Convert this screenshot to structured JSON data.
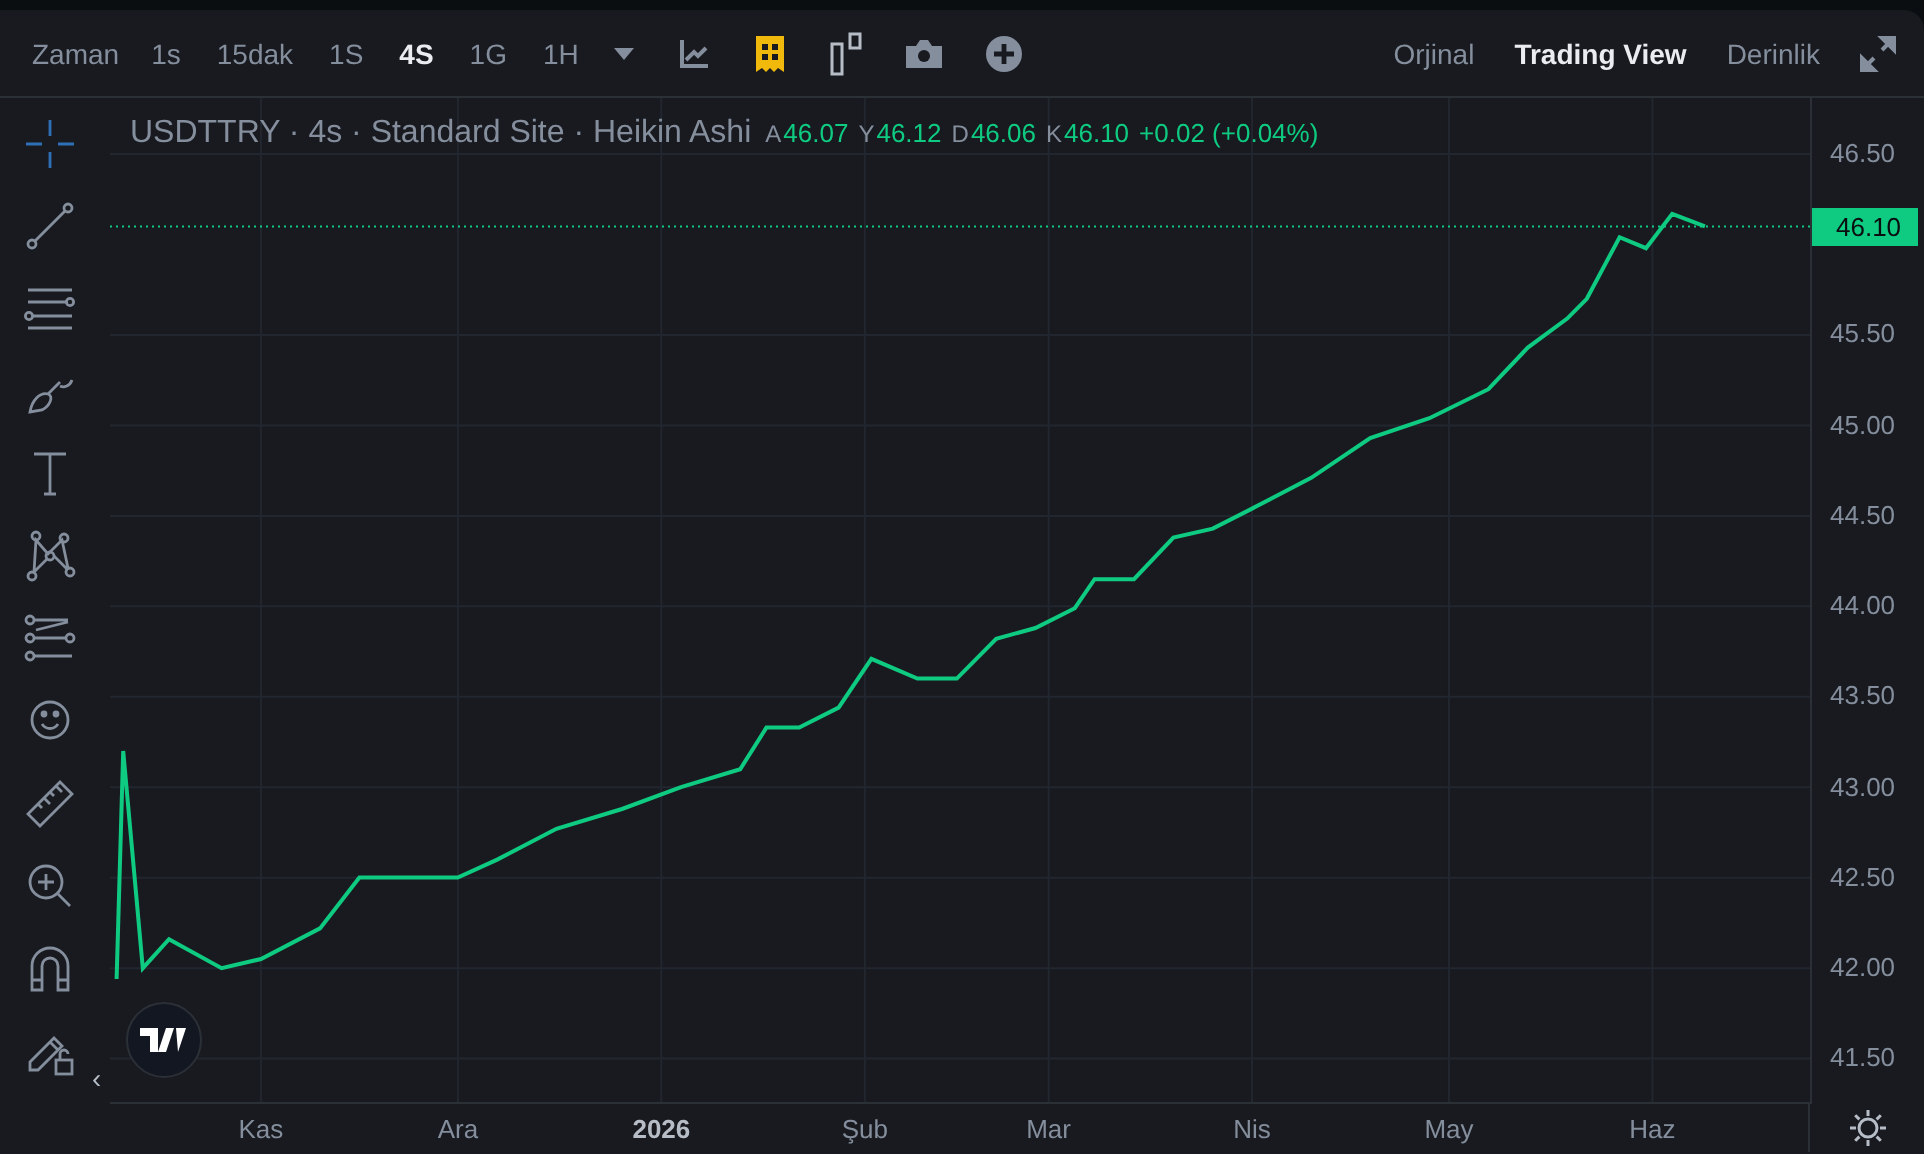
{
  "toolbar": {
    "time_label": "Zaman",
    "intervals": [
      {
        "label": "1s",
        "selected": false
      },
      {
        "label": "15dak",
        "selected": false
      },
      {
        "label": "1S",
        "selected": false
      },
      {
        "label": "4S",
        "selected": true
      },
      {
        "label": "1G",
        "selected": false
      },
      {
        "label": "1H",
        "selected": false
      }
    ],
    "views": [
      {
        "label": "Orjinal",
        "selected": false
      },
      {
        "label": "Trading View",
        "selected": true
      },
      {
        "label": "Derinlik",
        "selected": false
      }
    ]
  },
  "tools": [
    {
      "kind": "crosshair",
      "selected": true
    },
    {
      "kind": "trendline",
      "selected": false
    },
    {
      "kind": "hlines",
      "selected": false
    },
    {
      "kind": "brush",
      "selected": false
    },
    {
      "kind": "text",
      "selected": false
    },
    {
      "kind": "pattern",
      "selected": false
    },
    {
      "kind": "fib",
      "selected": false
    },
    {
      "kind": "smiley",
      "selected": false
    },
    {
      "kind": "ruler",
      "selected": false
    },
    {
      "kind": "zoom",
      "selected": false
    },
    {
      "kind": "magnet",
      "selected": false
    },
    {
      "kind": "lock",
      "selected": false
    }
  ],
  "collapse_arrow": "‹",
  "legend": {
    "title": "USDTTRY · 4s · Standard Site · Heikin Ashi",
    "ohlc": [
      {
        "key": "A",
        "value": "46.07"
      },
      {
        "key": "Y",
        "value": "46.12"
      },
      {
        "key": "D",
        "value": "46.06"
      },
      {
        "key": "K",
        "value": "46.10"
      }
    ],
    "change": "+0.02 (+0.04%)"
  },
  "last_price": "46.10",
  "chart": {
    "chart_data": {
      "type": "line",
      "x": [
        "2025-10-10",
        "2025-10-11",
        "2025-10-14",
        "2025-10-18",
        "2025-10-26",
        "2025-11-01",
        "2025-11-10",
        "2025-11-16",
        "2025-11-22",
        "2025-12-01",
        "2025-12-07",
        "2025-12-16",
        "2025-12-26",
        "2026-01-04",
        "2026-01-13",
        "2026-01-17",
        "2026-01-22",
        "2026-01-28",
        "2026-02-02",
        "2026-02-09",
        "2026-02-15",
        "2026-02-21",
        "2026-02-27",
        "2026-03-05",
        "2026-03-08",
        "2026-03-14",
        "2026-03-20",
        "2026-03-26",
        "2026-04-01",
        "2026-04-10",
        "2026-04-19",
        "2026-04-28",
        "2026-05-07",
        "2026-05-13",
        "2026-05-19",
        "2026-05-22",
        "2026-05-27",
        "2026-05-31",
        "2026-06-04",
        "2026-06-09"
      ],
      "series": [
        {
          "color": "#0ecb81",
          "values": [
            41.94,
            43.2,
            42.0,
            42.16,
            42.0,
            42.05,
            42.22,
            42.5,
            42.5,
            42.5,
            42.6,
            42.77,
            42.88,
            43.0,
            43.1,
            43.33,
            43.33,
            43.44,
            43.71,
            43.6,
            43.6,
            43.82,
            43.88,
            43.99,
            44.15,
            44.15,
            44.38,
            44.43,
            44.54,
            44.71,
            44.93,
            45.04,
            45.2,
            45.43,
            45.59,
            45.7,
            46.04,
            45.98,
            46.17,
            46.1
          ]
        }
      ],
      "xlim": [
        "2025-10-09",
        "2026-06-25"
      ],
      "ylim": [
        41.26,
        46.81
      ],
      "grid": true,
      "ref_lines": [
        {
          "axis": "y",
          "value": 46.1,
          "color": "#0ecb81"
        }
      ],
      "xticks": [
        {
          "value": "2025-11-01",
          "label": "Kas"
        },
        {
          "value": "2025-12-01",
          "label": "Ara"
        },
        {
          "value": "2026-01-01",
          "label": "2026"
        },
        {
          "value": "2026-02-01",
          "label": "Şub"
        },
        {
          "value": "2026-03-01",
          "label": "Mar"
        },
        {
          "value": "2026-04-01",
          "label": "Nis"
        },
        {
          "value": "2026-05-01",
          "label": "May"
        },
        {
          "value": "2026-06-01",
          "label": "Haz"
        }
      ],
      "yticks": [
        {
          "value": 41.5,
          "label": "41.50"
        },
        {
          "value": 42.0,
          "label": "42.00"
        },
        {
          "value": 42.5,
          "label": "42.50"
        },
        {
          "value": 43.0,
          "label": "43.00"
        },
        {
          "value": 43.5,
          "label": "43.50"
        },
        {
          "value": 44.0,
          "label": "44.00"
        },
        {
          "value": 44.5,
          "label": "44.50"
        },
        {
          "value": 45.0,
          "label": "45.00"
        },
        {
          "value": 45.5,
          "label": "45.50"
        },
        {
          "value": 46.5,
          "label": "46.50"
        }
      ]
    }
  }
}
